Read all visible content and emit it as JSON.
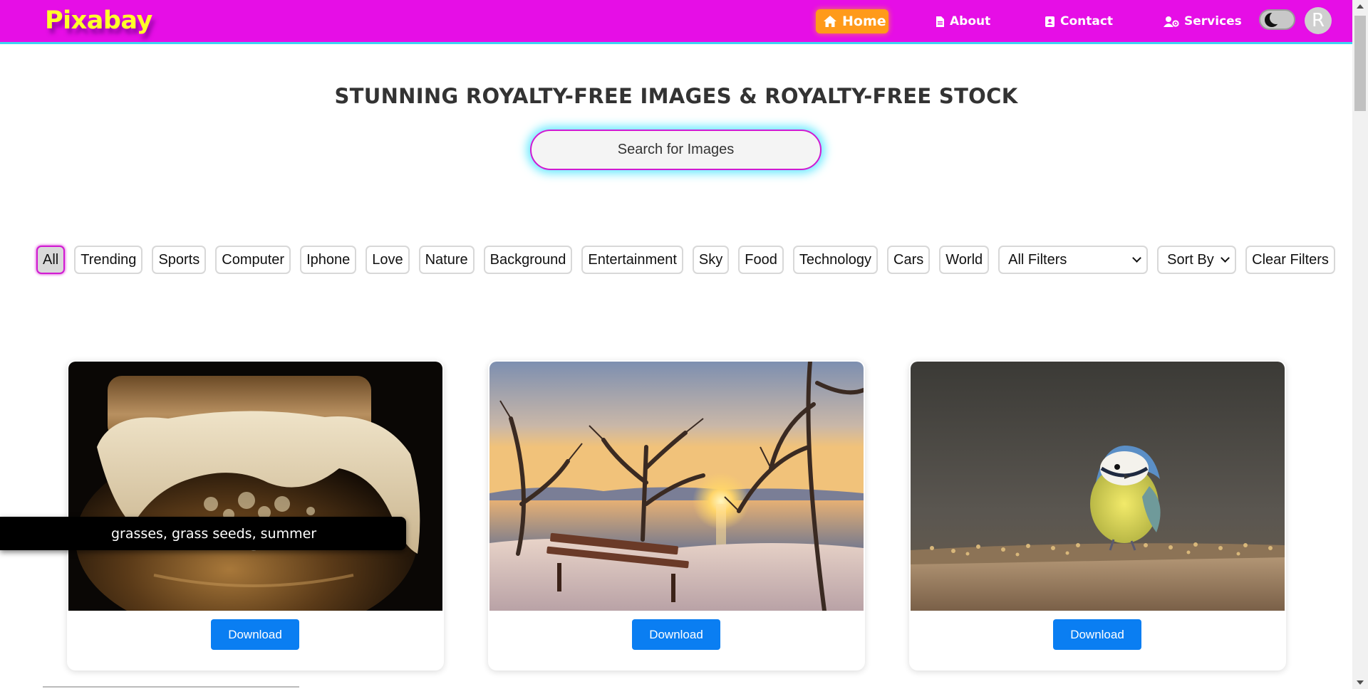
{
  "brand": {
    "logo": "Pixabay"
  },
  "nav": {
    "home": "Home",
    "about": "About",
    "contact": "Contact",
    "services": "Services",
    "avatar_letter": "R"
  },
  "hero": {
    "title": "STUNNING ROYALTY-FREE IMAGES & ROYALTY-FREE STOCK",
    "search_placeholder": "Search for Images"
  },
  "filters": {
    "categories": [
      "All",
      "Trending",
      "Sports",
      "Computer",
      "Iphone",
      "Love",
      "Nature",
      "Background",
      "Entertainment",
      "Sky",
      "Food",
      "Technology",
      "Cars",
      "World"
    ],
    "active": "All",
    "all_filters": "All Filters",
    "sort_by": "Sort By",
    "clear": "Clear Filters"
  },
  "cards": [
    {
      "image": "jar-with-cloth-photo",
      "button": "Download"
    },
    {
      "image": "winter-sunset-bench-photo",
      "button": "Download"
    },
    {
      "image": "blue-tit-bird-photo",
      "button": "Download"
    }
  ],
  "tooltip": {
    "text": "grasses, grass seeds, summer"
  },
  "colors": {
    "navbar": "#e60ee6",
    "logo": "#ffff2a",
    "active_nav": "#ff9a1a",
    "download": "#0a7ef2",
    "search_glow": "#5fe8ff"
  }
}
